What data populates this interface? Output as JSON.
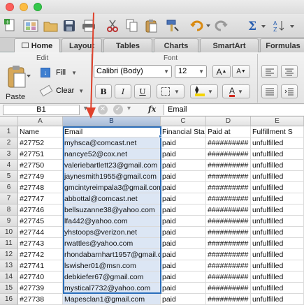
{
  "toolbar_icons": [
    "new-icon",
    "templates-icon",
    "save-icon",
    "print-icon",
    "cut-icon",
    "copy-icon",
    "paste-icon",
    "format-painter-icon",
    "undo-icon",
    "redo-icon",
    "autosum-icon",
    "sort-icon"
  ],
  "tabs": [
    "Home",
    "Layout",
    "Tables",
    "Charts",
    "SmartArt",
    "Formulas"
  ],
  "ribbon": {
    "edit_group": "Edit",
    "font_group": "Font",
    "paste": "Paste",
    "fill": "Fill",
    "clear": "Clear",
    "font_name": "Calibri (Body)",
    "font_size": "12",
    "bold": "B",
    "italic": "I",
    "underline": "U",
    "inc_font": "A",
    "dec_font": "A",
    "font_color": "A"
  },
  "formula_bar": {
    "name_box": "B1",
    "fx": "fx",
    "value": "Email"
  },
  "columns": [
    "A",
    "B",
    "C",
    "D",
    "E"
  ],
  "rows": [
    {
      "n": "1",
      "a": "Name",
      "b": "Email",
      "c": "Financial Sta",
      "d": "Paid at",
      "e": "Fulfillment S"
    },
    {
      "n": "2",
      "a": "#27752",
      "b": "myhsca@comcast.net",
      "c": "paid",
      "d": "##########",
      "e": "unfulfilled"
    },
    {
      "n": "3",
      "a": "#27751",
      "b": "nancye52@cox.net",
      "c": "paid",
      "d": "##########",
      "e": "unfulfilled"
    },
    {
      "n": "4",
      "a": "#27750",
      "b": "valeriebartlett23@gmail.com",
      "c": "paid",
      "d": "##########",
      "e": "unfulfilled"
    },
    {
      "n": "5",
      "a": "#27749",
      "b": "jaynesmith1955@gmail.com",
      "c": "paid",
      "d": "##########",
      "e": "unfulfilled"
    },
    {
      "n": "6",
      "a": "#27748",
      "b": "gmcintyreimpala3@gmail.com",
      "c": "paid",
      "d": "##########",
      "e": "unfulfilled"
    },
    {
      "n": "7",
      "a": "#27747",
      "b": "abbottal@comcast.net",
      "c": "paid",
      "d": "##########",
      "e": "unfulfilled"
    },
    {
      "n": "8",
      "a": "#27746",
      "b": "bellsuzanne38@yahoo.com",
      "c": "paid",
      "d": "##########",
      "e": "unfulfilled"
    },
    {
      "n": "9",
      "a": "#27745",
      "b": "lfa442@yahoo.com",
      "c": "paid",
      "d": "##########",
      "e": "unfulfilled"
    },
    {
      "n": "10",
      "a": "#27744",
      "b": "yhstoops@verizon.net",
      "c": "paid",
      "d": "##########",
      "e": "unfulfilled"
    },
    {
      "n": "11",
      "a": "#27743",
      "b": "rwattles@yahoo.com",
      "c": "paid",
      "d": "##########",
      "e": "unfulfilled"
    },
    {
      "n": "12",
      "a": "#27742",
      "b": "rhondabarnhart1957@gmail.com",
      "c": "paid",
      "d": "##########",
      "e": "unfulfilled"
    },
    {
      "n": "13",
      "a": "#27741",
      "b": "lswisher01@msn.com",
      "c": "paid",
      "d": "##########",
      "e": "unfulfilled"
    },
    {
      "n": "14",
      "a": "#27740",
      "b": "debkiefer67@gmail.com",
      "c": "paid",
      "d": "##########",
      "e": "unfulfilled"
    },
    {
      "n": "15",
      "a": "#27739",
      "b": "mystical7732@yahoo.com",
      "c": "paid",
      "d": "##########",
      "e": "unfulfilled"
    },
    {
      "n": "16",
      "a": "#27738",
      "b": "Mapesclan1@gmail.com",
      "c": "paid",
      "d": "##########",
      "e": "unfulfilled"
    }
  ],
  "colors": {
    "annotation_arrow": "#e0412b",
    "selection": "#dce6f4",
    "accent": "#2a6ebb"
  }
}
